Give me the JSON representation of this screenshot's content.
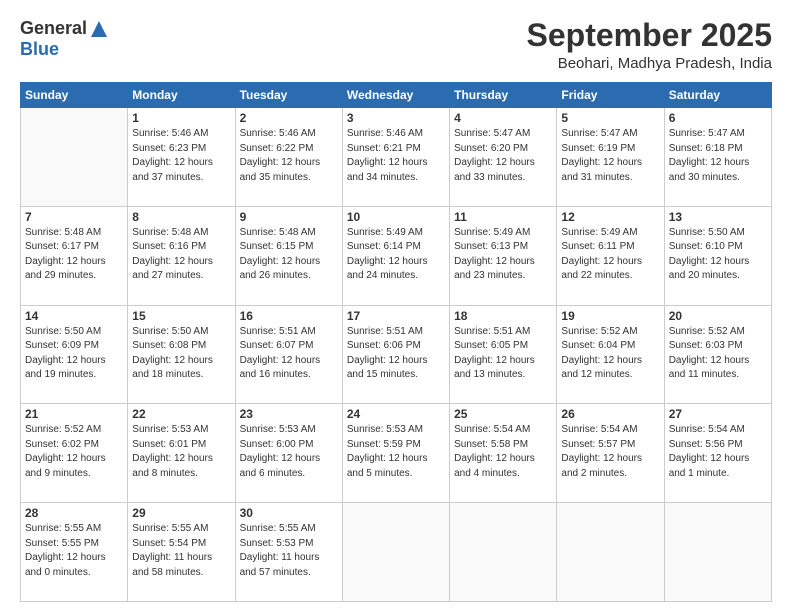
{
  "logo": {
    "general": "General",
    "blue": "Blue"
  },
  "title": "September 2025",
  "location": "Beohari, Madhya Pradesh, India",
  "days_header": [
    "Sunday",
    "Monday",
    "Tuesday",
    "Wednesday",
    "Thursday",
    "Friday",
    "Saturday"
  ],
  "weeks": [
    [
      {
        "day": "",
        "info": ""
      },
      {
        "day": "1",
        "info": "Sunrise: 5:46 AM\nSunset: 6:23 PM\nDaylight: 12 hours\nand 37 minutes."
      },
      {
        "day": "2",
        "info": "Sunrise: 5:46 AM\nSunset: 6:22 PM\nDaylight: 12 hours\nand 35 minutes."
      },
      {
        "day": "3",
        "info": "Sunrise: 5:46 AM\nSunset: 6:21 PM\nDaylight: 12 hours\nand 34 minutes."
      },
      {
        "day": "4",
        "info": "Sunrise: 5:47 AM\nSunset: 6:20 PM\nDaylight: 12 hours\nand 33 minutes."
      },
      {
        "day": "5",
        "info": "Sunrise: 5:47 AM\nSunset: 6:19 PM\nDaylight: 12 hours\nand 31 minutes."
      },
      {
        "day": "6",
        "info": "Sunrise: 5:47 AM\nSunset: 6:18 PM\nDaylight: 12 hours\nand 30 minutes."
      }
    ],
    [
      {
        "day": "7",
        "info": "Sunrise: 5:48 AM\nSunset: 6:17 PM\nDaylight: 12 hours\nand 29 minutes."
      },
      {
        "day": "8",
        "info": "Sunrise: 5:48 AM\nSunset: 6:16 PM\nDaylight: 12 hours\nand 27 minutes."
      },
      {
        "day": "9",
        "info": "Sunrise: 5:48 AM\nSunset: 6:15 PM\nDaylight: 12 hours\nand 26 minutes."
      },
      {
        "day": "10",
        "info": "Sunrise: 5:49 AM\nSunset: 6:14 PM\nDaylight: 12 hours\nand 24 minutes."
      },
      {
        "day": "11",
        "info": "Sunrise: 5:49 AM\nSunset: 6:13 PM\nDaylight: 12 hours\nand 23 minutes."
      },
      {
        "day": "12",
        "info": "Sunrise: 5:49 AM\nSunset: 6:11 PM\nDaylight: 12 hours\nand 22 minutes."
      },
      {
        "day": "13",
        "info": "Sunrise: 5:50 AM\nSunset: 6:10 PM\nDaylight: 12 hours\nand 20 minutes."
      }
    ],
    [
      {
        "day": "14",
        "info": "Sunrise: 5:50 AM\nSunset: 6:09 PM\nDaylight: 12 hours\nand 19 minutes."
      },
      {
        "day": "15",
        "info": "Sunrise: 5:50 AM\nSunset: 6:08 PM\nDaylight: 12 hours\nand 18 minutes."
      },
      {
        "day": "16",
        "info": "Sunrise: 5:51 AM\nSunset: 6:07 PM\nDaylight: 12 hours\nand 16 minutes."
      },
      {
        "day": "17",
        "info": "Sunrise: 5:51 AM\nSunset: 6:06 PM\nDaylight: 12 hours\nand 15 minutes."
      },
      {
        "day": "18",
        "info": "Sunrise: 5:51 AM\nSunset: 6:05 PM\nDaylight: 12 hours\nand 13 minutes."
      },
      {
        "day": "19",
        "info": "Sunrise: 5:52 AM\nSunset: 6:04 PM\nDaylight: 12 hours\nand 12 minutes."
      },
      {
        "day": "20",
        "info": "Sunrise: 5:52 AM\nSunset: 6:03 PM\nDaylight: 12 hours\nand 11 minutes."
      }
    ],
    [
      {
        "day": "21",
        "info": "Sunrise: 5:52 AM\nSunset: 6:02 PM\nDaylight: 12 hours\nand 9 minutes."
      },
      {
        "day": "22",
        "info": "Sunrise: 5:53 AM\nSunset: 6:01 PM\nDaylight: 12 hours\nand 8 minutes."
      },
      {
        "day": "23",
        "info": "Sunrise: 5:53 AM\nSunset: 6:00 PM\nDaylight: 12 hours\nand 6 minutes."
      },
      {
        "day": "24",
        "info": "Sunrise: 5:53 AM\nSunset: 5:59 PM\nDaylight: 12 hours\nand 5 minutes."
      },
      {
        "day": "25",
        "info": "Sunrise: 5:54 AM\nSunset: 5:58 PM\nDaylight: 12 hours\nand 4 minutes."
      },
      {
        "day": "26",
        "info": "Sunrise: 5:54 AM\nSunset: 5:57 PM\nDaylight: 12 hours\nand 2 minutes."
      },
      {
        "day": "27",
        "info": "Sunrise: 5:54 AM\nSunset: 5:56 PM\nDaylight: 12 hours\nand 1 minute."
      }
    ],
    [
      {
        "day": "28",
        "info": "Sunrise: 5:55 AM\nSunset: 5:55 PM\nDaylight: 12 hours\nand 0 minutes."
      },
      {
        "day": "29",
        "info": "Sunrise: 5:55 AM\nSunset: 5:54 PM\nDaylight: 11 hours\nand 58 minutes."
      },
      {
        "day": "30",
        "info": "Sunrise: 5:55 AM\nSunset: 5:53 PM\nDaylight: 11 hours\nand 57 minutes."
      },
      {
        "day": "",
        "info": ""
      },
      {
        "day": "",
        "info": ""
      },
      {
        "day": "",
        "info": ""
      },
      {
        "day": "",
        "info": ""
      }
    ]
  ]
}
